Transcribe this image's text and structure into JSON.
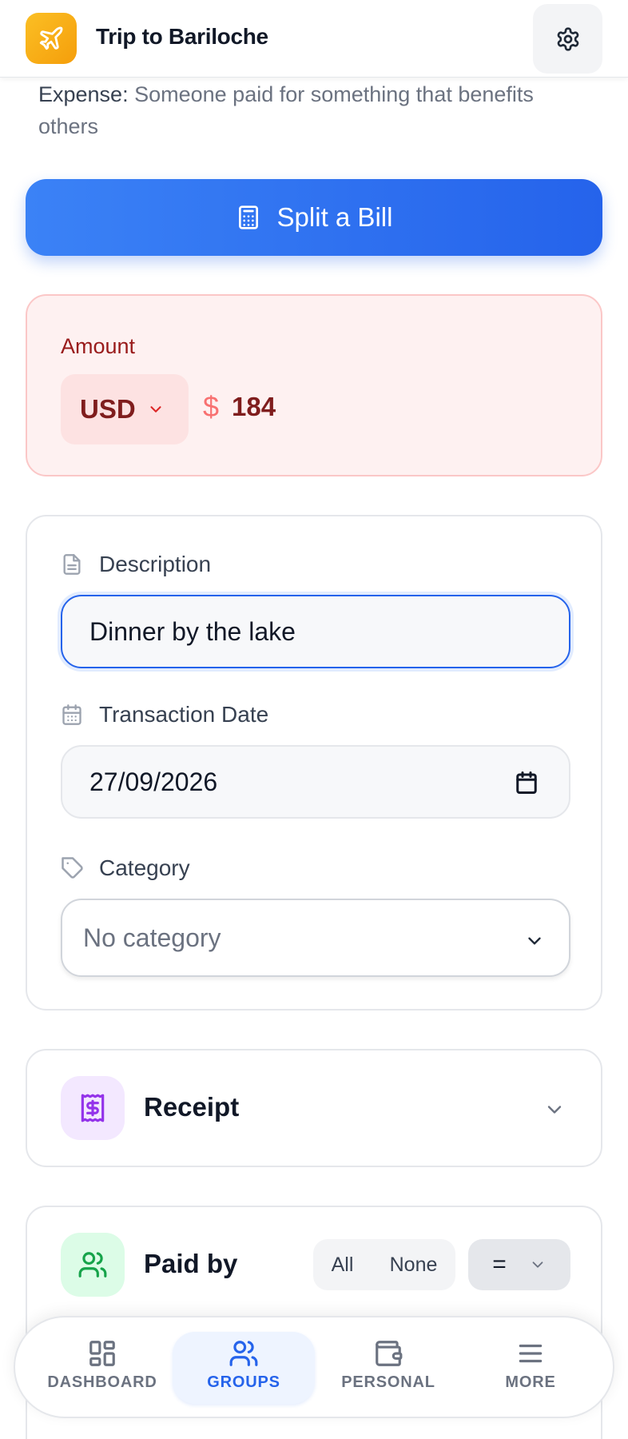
{
  "header": {
    "title": "Trip to Bariloche",
    "logo_icon": "airplane-icon",
    "settings_icon": "gear-icon"
  },
  "hint": {
    "label": "Expense:",
    "text": "Someone paid for something that benefits others"
  },
  "split_bill": {
    "label": "Split a Bill",
    "icon": "calculator-icon"
  },
  "amount": {
    "label": "Amount",
    "currency": "USD",
    "symbol": "$",
    "value": "184"
  },
  "description": {
    "label": "Description",
    "value": "Dinner by the lake"
  },
  "transaction_date": {
    "label": "Transaction Date",
    "value": "27/09/2026"
  },
  "category": {
    "label": "Category",
    "value": "No category"
  },
  "receipt": {
    "title": "Receipt"
  },
  "paid_by": {
    "title": "Paid by",
    "all_label": "All",
    "none_label": "None",
    "mode_value": "="
  },
  "nav": {
    "items": [
      {
        "label": "DASHBOARD",
        "icon": "grid-icon"
      },
      {
        "label": "GROUPS",
        "icon": "users-icon",
        "active": true
      },
      {
        "label": "PERSONAL",
        "icon": "wallet-icon"
      },
      {
        "label": "MORE",
        "icon": "menu-icon"
      }
    ]
  },
  "colors": {
    "accent": "#2563eb",
    "logo": "#f59e0b",
    "amount_bg": "#fef1f1",
    "amount_text": "#7f1d1d",
    "receipt_icon_bg": "#f3e8ff",
    "paidby_icon_bg": "#dcfce7"
  }
}
